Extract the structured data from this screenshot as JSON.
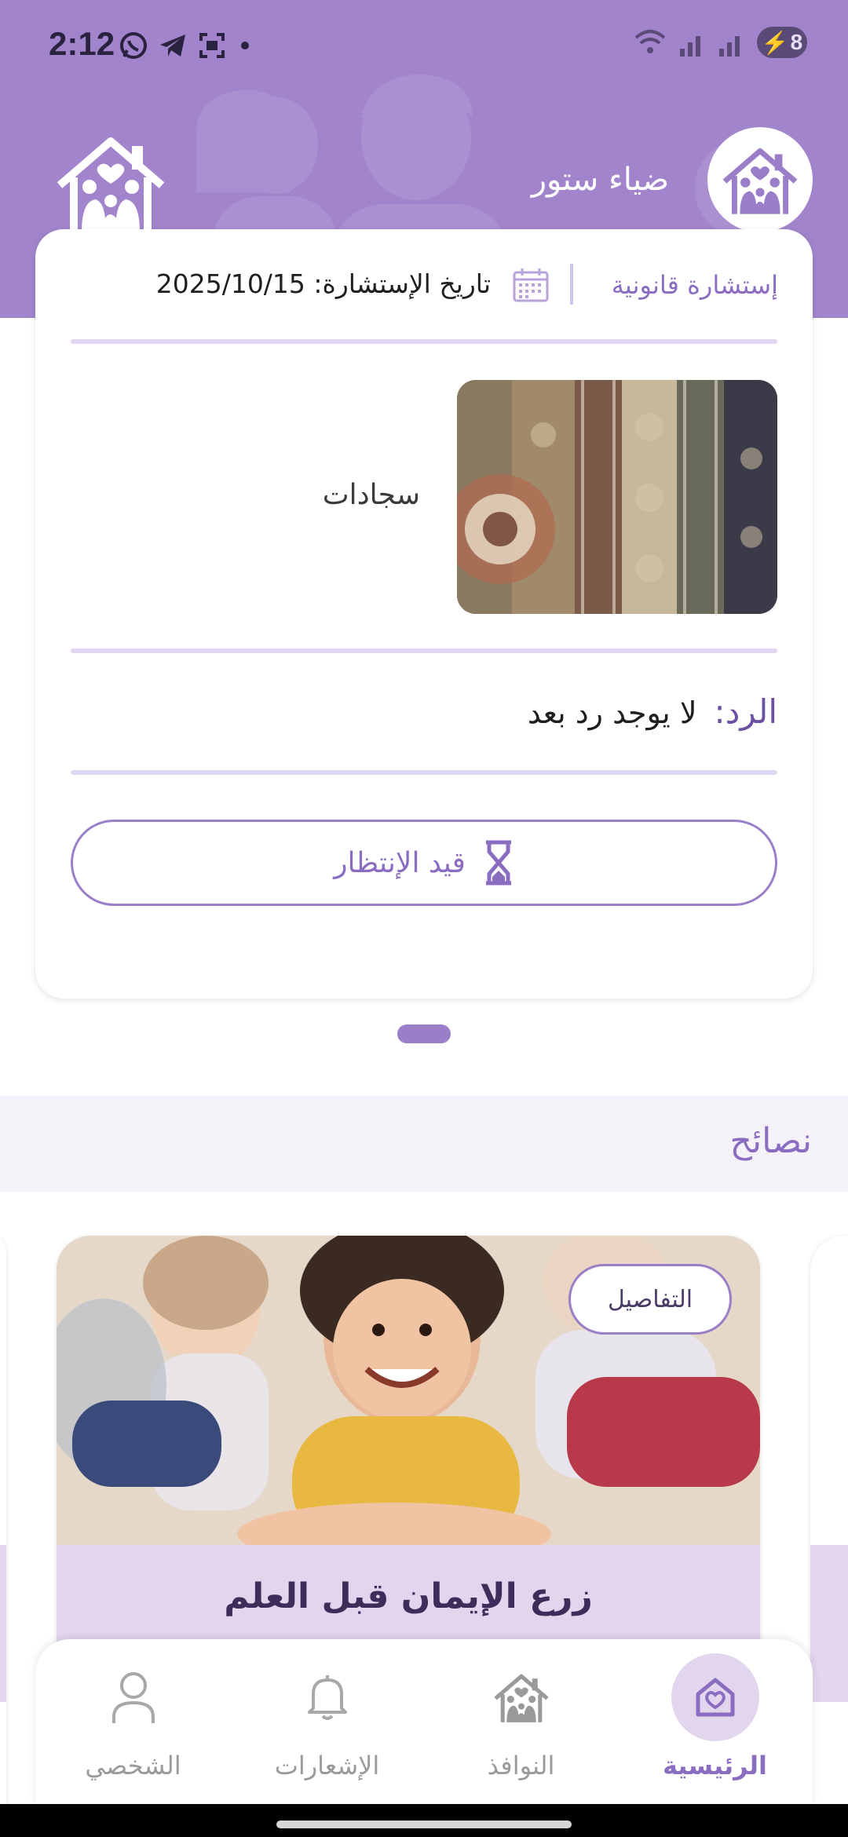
{
  "status_bar": {
    "time": "2:12",
    "battery": "8"
  },
  "header": {
    "store_name": "ضياء ستور"
  },
  "consultation": {
    "type": "إستشارة قانونية",
    "date_text": "تاريخ الإستشارة: 2025/10/15",
    "product_name": "سجادات",
    "reply_label": "الرد:",
    "reply_text": "لا يوجد رد بعد",
    "status": "قيد الإنتظار"
  },
  "tips": {
    "section_title": "نصائح",
    "cards": [
      {
        "title": "زرع الإيمان قبل العلم",
        "details_label": "التفاصيل"
      }
    ]
  },
  "bottom_nav": {
    "items": [
      {
        "label": "الرئيسية",
        "icon": "home-heart-icon",
        "active": true
      },
      {
        "label": "النوافذ",
        "icon": "family-house-icon",
        "active": false
      },
      {
        "label": "الإشعارات",
        "icon": "bell-icon",
        "active": false
      },
      {
        "label": "الشخصي",
        "icon": "person-icon",
        "active": false
      }
    ]
  },
  "colors": {
    "primary": "#a284cc",
    "accent": "#8a6cc0",
    "light_accent": "#e2d6ee"
  }
}
